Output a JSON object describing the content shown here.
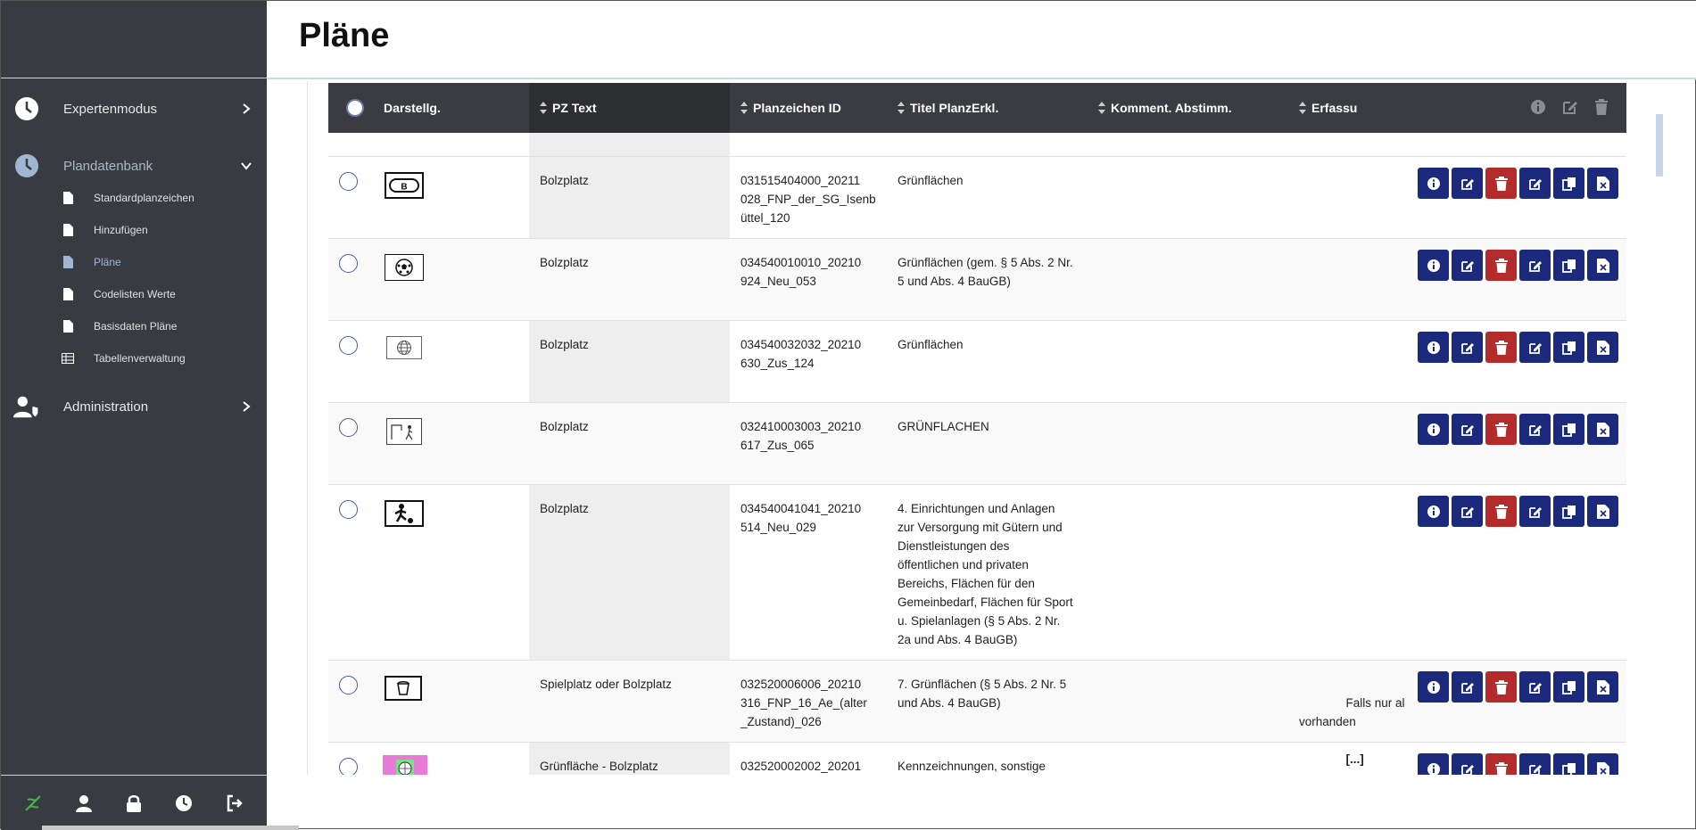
{
  "page": {
    "title": "Pläne"
  },
  "sidebar": {
    "expertenmodus": "Expertenmodus",
    "plandatenbank": "Plandatenbank",
    "subitems": [
      "Standardplanzeichen",
      "Hinzufügen",
      "Pläne",
      "Codelisten Werte",
      "Basisdaten Pläne",
      "Tabellenverwaltung"
    ],
    "administration": "Administration"
  },
  "table": {
    "headers": {
      "darstellg": "Darstellg.",
      "pz_text": "PZ Text",
      "planzeichen_id": "Planzeichen ID",
      "titel": "Titel PlanzErkl.",
      "komment": "Komment. Abstimm.",
      "erfassung": "Erfassu"
    },
    "rows": [
      {
        "pz_text": "Bolzplatz",
        "planzeichen_id": "031515404000_20211\n028_FNP_der_SG_Isenb\nüttel_120",
        "titel": "Grünflächen",
        "erfassung": "",
        "thumb_icon": "letter-b-icon"
      },
      {
        "pz_text": "Bolzplatz",
        "planzeichen_id": "034540010010_20210\n924_Neu_053",
        "titel": "Grünflächen (gem. § 5 Abs. 2 Nr.\n5 und Abs. 4 BauGB)",
        "erfassung": "",
        "thumb_icon": "soccer-ball-icon"
      },
      {
        "pz_text": "Bolzplatz",
        "planzeichen_id": "034540032032_20210\n630_Zus_124",
        "titel": "Grünflächen",
        "erfassung": "",
        "thumb_icon": "globe-ball-icon"
      },
      {
        "pz_text": "Bolzplatz",
        "planzeichen_id": "032410003003_20210\n617_Zus_065",
        "titel": "GRÜNFLACHEN",
        "erfassung": "",
        "thumb_icon": "goal-player-icon"
      },
      {
        "pz_text": "Bolzplatz",
        "planzeichen_id": "034540041041_20210\n514_Neu_029",
        "titel": "4. Einrichtungen und Anlagen\nzur Versorgung mit Gütern und\nDienstleistungen des\nöffentlichen und privaten\nBereichs, Flächen für den\nGemeinbedarf, Flächen für Sport\nu. Spielanlagen (§ 5 Abs. 2 Nr.\n2a und Abs. 4 BauGB)",
        "erfassung": "",
        "thumb_icon": "kicking-player-icon"
      },
      {
        "pz_text": "Spielplatz oder Bolzplatz",
        "planzeichen_id": "032520006006_20210\n316_FNP_16_Ae_(alter\n_Zustand)_026",
        "titel": "7. Grünflächen (§ 5 Abs. 2 Nr. 5\nund Abs. 4 BauGB)",
        "erfassung": "Falls nur al\nvorhanden",
        "erfassung_more": "[...]",
        "thumb_icon": "bucket-icon"
      },
      {
        "pz_text": "Grünfläche - Bolzplatz",
        "planzeichen_id": "032520002002_20201",
        "titel": "Kennzeichnungen, sonstige",
        "erfassung": "",
        "thumb_icon": "colored-ball-icon"
      }
    ]
  },
  "colors": {
    "sidebar_bg": "#383b42",
    "header_bg": "#3a3c41",
    "action_blue": "#1b2a7d",
    "action_red": "#b32b2b",
    "active_link": "#9fb6d3"
  }
}
